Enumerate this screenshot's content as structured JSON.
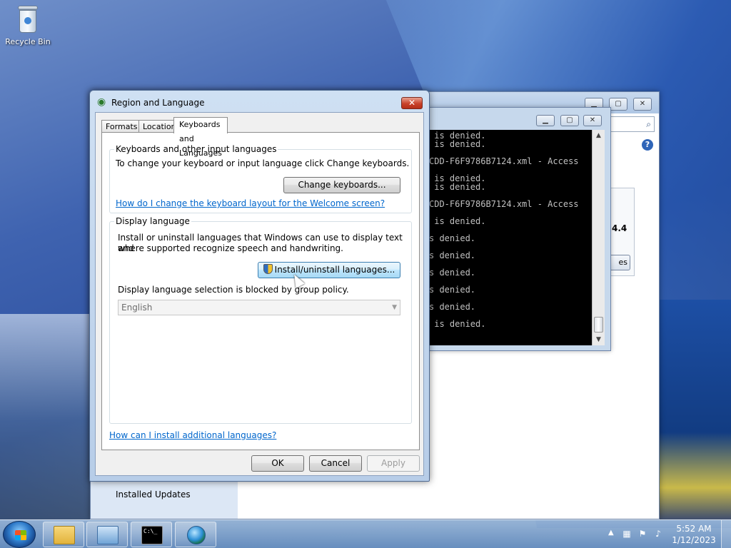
{
  "desktop": {
    "recycle_bin_label": "Recycle Bin"
  },
  "background_window": {
    "sidebar_link": "Installed Updates",
    "partial_version": "4.4",
    "partial_button": "es",
    "help_icon": "?"
  },
  "cmd_window": {
    "lines": [
      " is denied.",
      " is denied.",
      "",
      "CDD-F6F9786B7124.xml - Access",
      "",
      " is denied.",
      " is denied.",
      "",
      "CDD-F6F9786B7124.xml - Access",
      "",
      " is denied.",
      "",
      "s denied.",
      "",
      "s denied.",
      "",
      "s denied.",
      "",
      "s denied.",
      "",
      "s denied.",
      "",
      " is denied."
    ]
  },
  "dialog": {
    "title": "Region and Language",
    "tabs": [
      {
        "label": "Formats",
        "active": false
      },
      {
        "label": "Location",
        "active": false
      },
      {
        "label": "Keyboards and Languages",
        "active": true
      }
    ],
    "keyboards_group": {
      "label": "Keyboards and other input languages",
      "description": "To change your keyboard or input language click Change keyboards.",
      "change_button": "Change keyboards...",
      "link": "How do I change the keyboard layout for the Welcome screen?"
    },
    "display_group": {
      "label": "Display language",
      "description_line1": "Install or uninstall languages that Windows can use to display text and",
      "description_line2": "where supported recognize speech and handwriting.",
      "install_button": "Install/uninstall languages...",
      "blocked_text": "Display language selection is blocked by group policy.",
      "language_select_value": "English"
    },
    "bottom_link": "How can I install additional languages?",
    "buttons": {
      "ok": "OK",
      "cancel": "Cancel",
      "apply": "Apply"
    }
  },
  "taskbar": {
    "items": [
      "explorer",
      "control-panel",
      "command-prompt",
      "region-language"
    ],
    "clock_time": "5:52 AM",
    "clock_date": "1/12/2023"
  }
}
